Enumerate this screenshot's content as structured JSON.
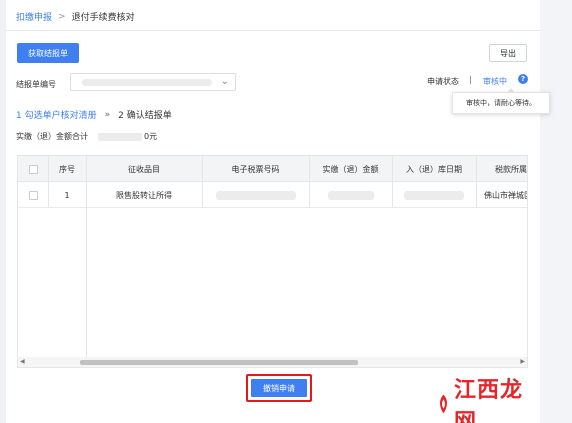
{
  "breadcrumb": {
    "parent": "扣缴申报",
    "separator": ">",
    "current": "退付手续费核对"
  },
  "toolbar": {
    "get_report_label": "获取结报单",
    "export_label": "导出"
  },
  "filter": {
    "report_no_label": "结报单编号"
  },
  "status": {
    "label": "申请状态",
    "separator": "|",
    "value": "审核中",
    "tooltip": "审核中，请耐心等待。"
  },
  "steps": {
    "step1": "1 勾选单户核对清册",
    "separator": "»",
    "step2": "2 确认结报单"
  },
  "total": {
    "label": "实缴（退）金额合计",
    "suffix": "0元"
  },
  "table": {
    "columns": [
      "序号",
      "征收品目",
      "电子税票号码",
      "实缴（退）金额",
      "入（退）库日期",
      "税款所属"
    ],
    "rows": [
      {
        "seq": "1",
        "item": "限售股转让所得",
        "tax_dept": "佛山市禅城区"
      }
    ]
  },
  "actions": {
    "cancel_label": "撤销申请"
  },
  "watermark": {
    "text": "江西龙网"
  },
  "colors": {
    "accent": "#3f7ff0",
    "highlight": "#e01b1b",
    "watermark": "#e6252a"
  }
}
